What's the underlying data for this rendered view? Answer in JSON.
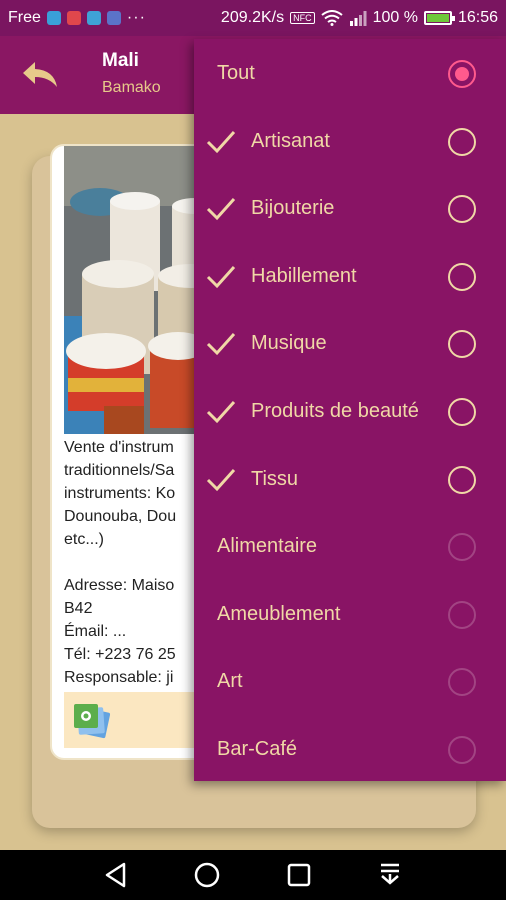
{
  "status_bar": {
    "carrier": "Free",
    "dots": "···",
    "speed": "209.2K/s",
    "nfc": "NFC",
    "battery": "100 %",
    "time": "16:56",
    "battery_color": "#6fc93a"
  },
  "app_bar": {
    "title": "Mali",
    "subtitle": "Bamako",
    "back_icon": "reply-arrow-icon"
  },
  "listing": {
    "description": "Vente d'instrum\ntraditionnels/Sa\ninstruments: Ko\nDounouba, Dou\netc...)\n\nAdresse: Maiso\nB42\nÉmail: ...\nTél: +223 76 25\nResponsable: ji",
    "gallery_icon": "gallery-icon"
  },
  "dropdown": {
    "items": [
      {
        "label": "Tout",
        "checked": false,
        "state": "selected"
      },
      {
        "label": "Artisanat",
        "checked": true,
        "state": "on"
      },
      {
        "label": "Bijouterie",
        "checked": true,
        "state": "on"
      },
      {
        "label": "Habillement",
        "checked": true,
        "state": "on"
      },
      {
        "label": "Musique",
        "checked": true,
        "state": "on"
      },
      {
        "label": "Produits de beauté",
        "checked": true,
        "state": "on"
      },
      {
        "label": "Tissu",
        "checked": true,
        "state": "on"
      },
      {
        "label": "Alimentaire",
        "checked": false,
        "state": "dim"
      },
      {
        "label": "Ameublement",
        "checked": false,
        "state": "dim"
      },
      {
        "label": "Art",
        "checked": false,
        "state": "dim"
      },
      {
        "label": "Bar-Café",
        "checked": false,
        "state": "dim"
      }
    ]
  },
  "nav_bar": {
    "back_icon": "triangle-back-icon",
    "home_icon": "circle-home-icon",
    "recents_icon": "square-recents-icon",
    "notif_icon": "pull-down-icon"
  },
  "colors": {
    "primary": "#8a1763",
    "accent_text": "#f0d8a6",
    "radio_selected": "#ff5a8d",
    "background": "#d8c290"
  }
}
